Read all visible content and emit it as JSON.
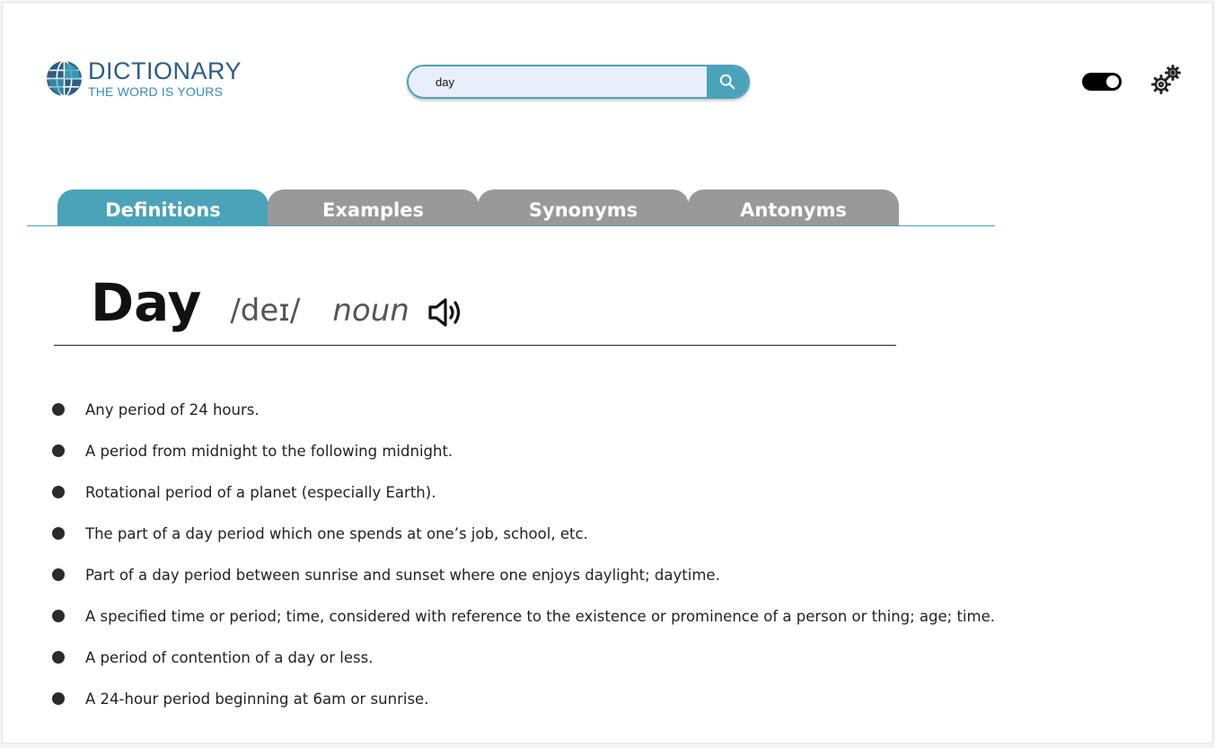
{
  "header": {
    "logo_title": "DICTIONARY",
    "logo_subtitle": "THE WORD IS YOURS",
    "logo_icon": "globe-icon",
    "search_value": "day",
    "search_icon": "search-icon",
    "theme_toggle_on": true,
    "settings_icon": "gears-icon"
  },
  "tabs": [
    {
      "label": "Definitions",
      "active": true
    },
    {
      "label": "Examples",
      "active": false
    },
    {
      "label": "Synonyms",
      "active": false
    },
    {
      "label": "Antonyms",
      "active": false
    }
  ],
  "entry": {
    "word": "Day",
    "phonetic": "/deɪ/",
    "part_of_speech": "noun",
    "audio_icon": "speaker-icon"
  },
  "definitions": [
    "Any period of 24 hours.",
    "A period from midnight to the following midnight.",
    "Rotational period of a planet (especially Earth).",
    "The part of a day period which one spends at one’s job, school, etc.",
    "Part of a day period between sunrise and sunset where one enjoys daylight; daytime.",
    "A specified time or period; time, considered with reference to the existence or prominence of a person or thing; age; time.",
    "A period of contention of a day or less.",
    "A 24-hour period beginning at 6am or sunrise."
  ],
  "colors": {
    "accent": "#4aa3b9",
    "tab_inactive": "#999999",
    "logo_dark": "#2d5c86",
    "logo_light": "#3a8ab5"
  }
}
